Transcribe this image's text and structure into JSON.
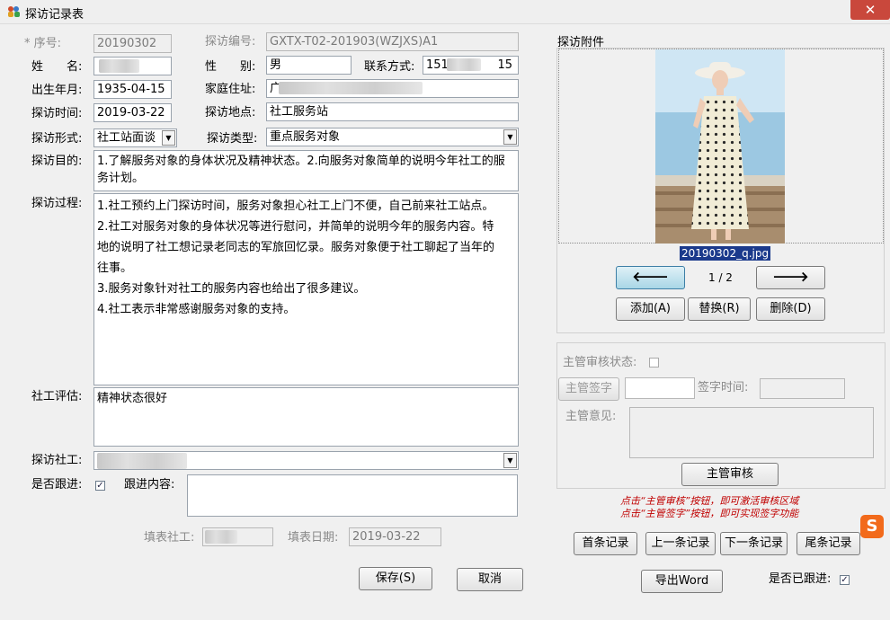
{
  "window": {
    "title": "探访记录表",
    "close_glyph": "✕"
  },
  "form": {
    "seq_label": "* 序号:",
    "seq_value": "20190302",
    "visit_no_label": "探访编号:",
    "visit_no_value": "GXTX-T02-201903(WZJXS)A1",
    "name_label": "姓　　名:",
    "name_value": "",
    "gender_label": "性　　别:",
    "gender_value": "男",
    "phone_label": "联系方式:",
    "phone_prefix": "151",
    "phone_suffix": "15",
    "birth_label": "出生年月:",
    "birth_value": "1935-04-15",
    "address_label": "家庭住址:",
    "address_prefix": "广",
    "visit_time_label": "探访时间:",
    "visit_time_value": "2019-03-22",
    "location_label": "探访地点:",
    "location_value": "社工服务站",
    "form_label": "探访形式:",
    "form_value": "社工站面谈",
    "type_label": "探访类型:",
    "type_value": "重点服务对象",
    "purpose_label": "探访目的:",
    "purpose_lines": [
      "1.了解服务对象的身体状况及精神状态。2.向服务对象简单的说明今年社工的服",
      "务计划。"
    ],
    "process_label": "探访过程:",
    "process_lines": [
      "1.社工预约上门探访时间，服务对象担心社工上门不便，自己前来社工站点。",
      "2.社工对服务对象的身体状况等进行慰问，并简单的说明今年的服务内容。特",
      "地的说明了社工想记录老同志的军旅回忆录。服务对象便于社工聊起了当年的",
      "往事。",
      "3.服务对象针对社工的服务内容也给出了很多建议。",
      "4.社工表示非常感谢服务对象的支持。"
    ],
    "eval_label": "社工评估:",
    "eval_value": "精神状态很好",
    "worker_label": "探访社工:",
    "follow_label": "是否跟进:",
    "follow_checked": "✓",
    "follow_content_label": "跟进内容:",
    "filler_label": "填表社工:",
    "fill_date_label": "填表日期:",
    "fill_date_value": "2019-03-22",
    "save_button": "保存(S)",
    "cancel_button": "取消"
  },
  "attachment": {
    "label": "探访附件",
    "filename": "20190302_q.jpg",
    "prev_glyph": "🡐",
    "next_glyph": "🡒",
    "pager": "1 / 2",
    "add_button": "添加(A)",
    "replace_button": "替换(R)",
    "delete_button": "删除(D)"
  },
  "review": {
    "status_label": "主管审核状态:",
    "sign_button": "主管签字",
    "sign_time_label": "签字时间:",
    "opinion_label": "主管意见:",
    "review_button": "主管审核",
    "hint_lines": [
      "点击“主管审核”按钮，即可激活审核区域",
      "点击“主管签字”按钮，即可实现签字功能"
    ]
  },
  "nav": {
    "first": "首条记录",
    "prev": "上一条记录",
    "next": "下一条记录",
    "last": "尾条记录",
    "export": "导出Word",
    "followed_label": "是否已跟进:",
    "followed_checked": "✓"
  },
  "ime": {
    "glyph": "S"
  },
  "colors": {
    "close_red": "#c9483c",
    "hint_red": "#c00000",
    "selection_blue": "#1b3a8c"
  }
}
